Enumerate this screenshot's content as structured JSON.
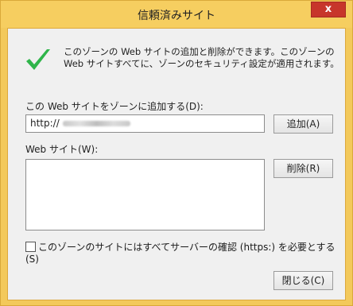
{
  "window": {
    "title": "信頼済みサイト",
    "close_label": "x"
  },
  "info": {
    "text": "このゾーンの Web サイトの追加と削除ができます。このゾーンの Web サイトすべてに、ゾーンのセキュリティ設定が適用されます。"
  },
  "add_section": {
    "label": "この Web サイトをゾーンに追加する(D):",
    "url_value": "http://",
    "add_button": "追加(A)"
  },
  "sites_section": {
    "label": "Web サイト(W):",
    "items": [],
    "remove_button": "削除(R)"
  },
  "https_option": {
    "label": "このゾーンのサイトにはすべてサーバーの確認 (https:) を必要とする(S)",
    "checked": false
  },
  "close_button": "閉じる(C)",
  "colors": {
    "title_bar": "#f6ce60",
    "close_button": "#c7362b",
    "check_mark": "#2fb54a"
  }
}
